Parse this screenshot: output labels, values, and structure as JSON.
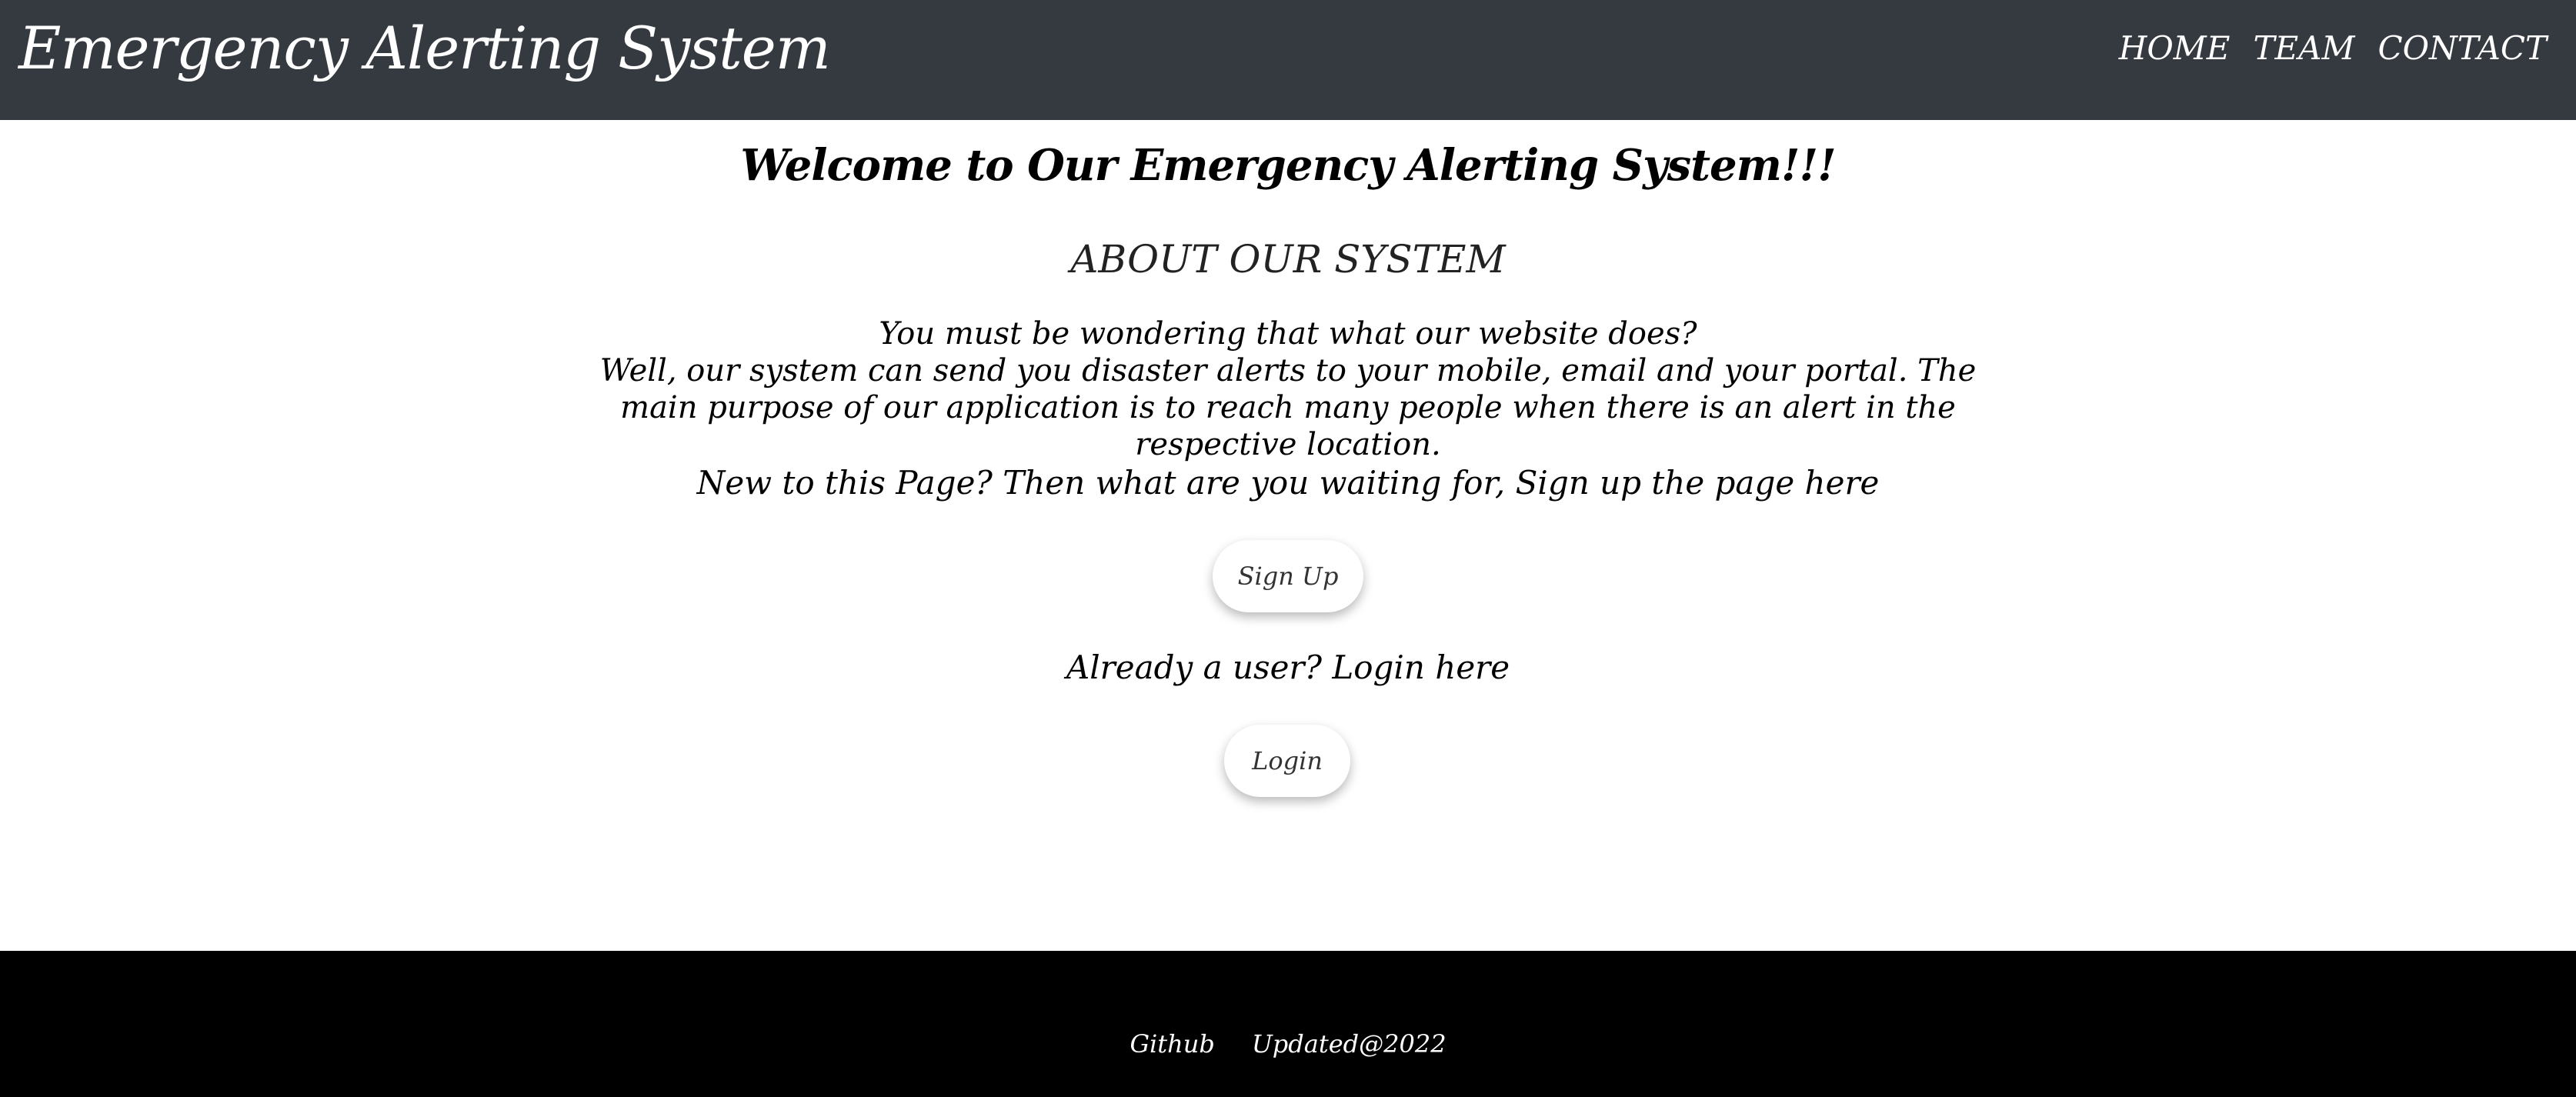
{
  "navbar": {
    "brand": "Emergency Alerting System",
    "links": [
      "HOME",
      "TEAM",
      "CONTACT"
    ]
  },
  "main": {
    "welcome": "Welcome to Our Emergency Alerting System!!!",
    "about_title": "ABOUT OUR SYSTEM",
    "about_line1": "You must be wondering that what our website does?",
    "about_line2": "Well, our system can send you disaster alerts to your mobile, email and your portal. The main purpose of our application is to reach many people when there is an alert in the respective location.",
    "signup_prompt": "New to this Page? Then what are you waiting for, Sign up the page here",
    "signup_button": "Sign Up",
    "login_prompt": "Already a user? Login here",
    "login_button": "Login"
  },
  "footer": {
    "links": [
      "Github",
      "Updated@2022"
    ]
  },
  "colors": {
    "navbar_bg": "#343a40",
    "footer_bg": "#000000",
    "page_bg": "#ffffff"
  }
}
